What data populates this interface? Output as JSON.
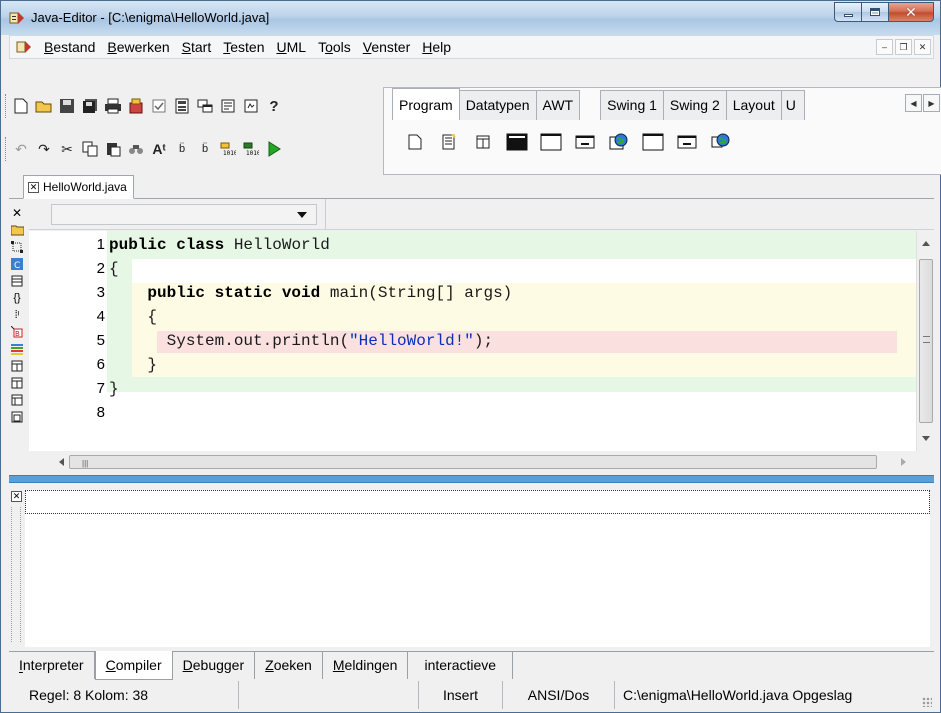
{
  "window": {
    "title": "Java-Editor - [C:\\enigma\\HelloWorld.java]",
    "accent": "#a9c6e3",
    "close_color": "#c34c30"
  },
  "menu": [
    {
      "label": "Bestand"
    },
    {
      "label": "Bewerken"
    },
    {
      "label": "Start"
    },
    {
      "label": "Testen"
    },
    {
      "label": "UML"
    },
    {
      "label": "Tools"
    },
    {
      "label": "Venster"
    },
    {
      "label": "Help"
    }
  ],
  "palette_tabs": [
    {
      "label": "Program",
      "active": true
    },
    {
      "label": "Datatypen"
    },
    {
      "label": "AWT"
    },
    {
      "label": "Swing 1"
    },
    {
      "label": "Swing 2"
    },
    {
      "label": "Layout"
    },
    {
      "label": "U"
    }
  ],
  "file_tab": {
    "label": "HelloWorld.java"
  },
  "editor": {
    "lines": [
      {
        "n": "1",
        "tokens": [
          {
            "t": "public class ",
            "c": "kw"
          },
          {
            "t": "HelloWorld",
            "c": "plain"
          }
        ]
      },
      {
        "n": "2",
        "tokens": [
          {
            "t": "{",
            "c": "plain"
          }
        ]
      },
      {
        "n": "3",
        "tokens": [
          {
            "t": "    ",
            "c": "plain"
          },
          {
            "t": "public static void ",
            "c": "kw"
          },
          {
            "t": "main(String[] args)",
            "c": "plain"
          }
        ]
      },
      {
        "n": "4",
        "tokens": [
          {
            "t": "    {",
            "c": "plain"
          }
        ]
      },
      {
        "n": "5",
        "tokens": [
          {
            "t": "      System.out.println(",
            "c": "plain"
          },
          {
            "t": "\"HelloWorld!\"",
            "c": "str"
          },
          {
            "t": ");",
            "c": "plain"
          }
        ]
      },
      {
        "n": "6",
        "tokens": [
          {
            "t": "    }",
            "c": "plain"
          }
        ]
      },
      {
        "n": "7",
        "tokens": [
          {
            "t": "}",
            "c": "plain"
          }
        ]
      },
      {
        "n": "8",
        "tokens": []
      }
    ],
    "colors": {
      "class_band": "#e6f7e6",
      "method_band": "#fdfbe3",
      "statement_band": "#fbe0e0",
      "string": "#0a2fb7"
    }
  },
  "bottom_tabs": [
    {
      "label": "Interpreter"
    },
    {
      "label": "Compiler",
      "active": true
    },
    {
      "label": "Debugger"
    },
    {
      "label": "Zoeken"
    },
    {
      "label": "Meldingen"
    },
    {
      "label": "interactieve"
    }
  ],
  "status": {
    "position": "Regel:  8 Kolom: 38",
    "mode": "Insert",
    "encoding": "ANSI/Dos",
    "file": "C:\\enigma\\HelloWorld.java Opgeslag"
  }
}
